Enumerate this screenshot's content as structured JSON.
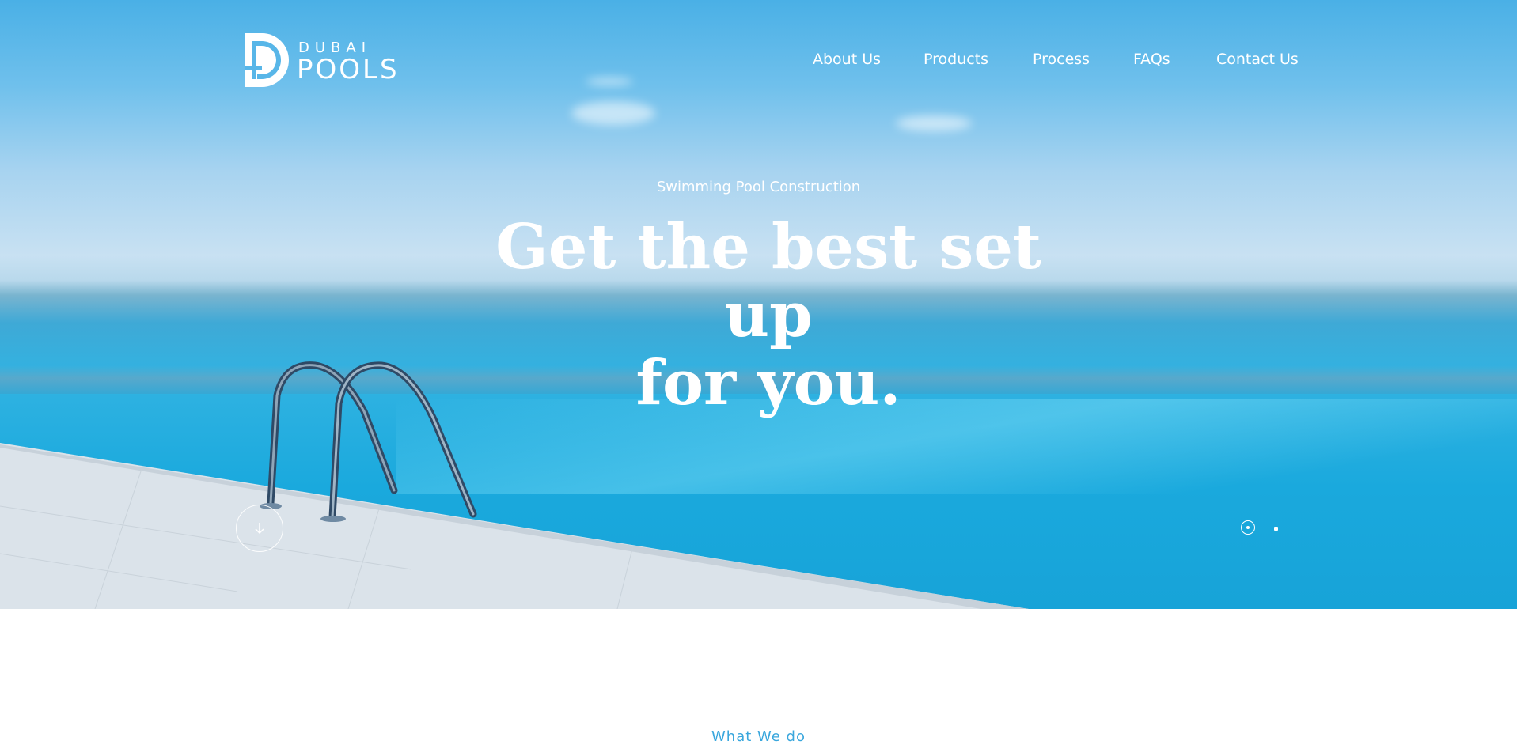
{
  "brand": {
    "name_top": "DUBAI",
    "name_bottom": "POOLS",
    "color_white": "#ffffff"
  },
  "nav": {
    "items": [
      {
        "label": "About Us"
      },
      {
        "label": "Products"
      },
      {
        "label": "Process"
      },
      {
        "label": "FAQs"
      },
      {
        "label": "Contact Us"
      }
    ]
  },
  "hero": {
    "eyebrow": "Swimming Pool Construction",
    "headline_line1": "Get the best set up",
    "headline_line2": "for you.",
    "background_image": "infinity pool with ladder overlooking sea",
    "scroll_icon": "arrow-down-icon",
    "slider": {
      "total": 2,
      "active": 1
    }
  },
  "next_section": {
    "title": "What We do"
  },
  "colors": {
    "sky": "#4ab0e6",
    "water": "#1aa9dd",
    "accent": "#3aa7dd",
    "page_bg": "#ffffff"
  }
}
